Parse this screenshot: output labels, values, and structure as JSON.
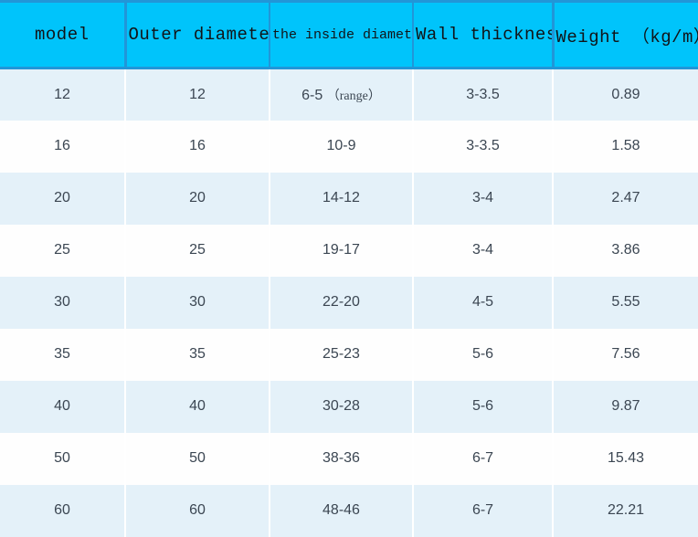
{
  "table": {
    "columns": [
      {
        "label": "model",
        "style": "mono"
      },
      {
        "label": "Outer diameter",
        "style": "mono"
      },
      {
        "label": "the inside diameter of",
        "style": "narrow"
      },
      {
        "label": "Wall thickness",
        "style": "mono"
      },
      {
        "label": "Weight （kg/m）",
        "style": "mono"
      }
    ],
    "rows": [
      {
        "model": "12",
        "outer_diameter": "12",
        "inside_diameter": "6-5",
        "inside_diameter_note": "（range）",
        "wall_thickness": "3-3.5",
        "weight": "0.89"
      },
      {
        "model": "16",
        "outer_diameter": "16",
        "inside_diameter": "10-9",
        "inside_diameter_note": "",
        "wall_thickness": "3-3.5",
        "weight": "1.58"
      },
      {
        "model": "20",
        "outer_diameter": "20",
        "inside_diameter": "14-12",
        "inside_diameter_note": "",
        "wall_thickness": "3-4",
        "weight": "2.47"
      },
      {
        "model": "25",
        "outer_diameter": "25",
        "inside_diameter": "19-17",
        "inside_diameter_note": "",
        "wall_thickness": "3-4",
        "weight": "3.86"
      },
      {
        "model": "30",
        "outer_diameter": "30",
        "inside_diameter": "22-20",
        "inside_diameter_note": "",
        "wall_thickness": "4-5",
        "weight": "5.55"
      },
      {
        "model": "35",
        "outer_diameter": "35",
        "inside_diameter": "25-23",
        "inside_diameter_note": "",
        "wall_thickness": "5-6",
        "weight": "7.56"
      },
      {
        "model": "40",
        "outer_diameter": "40",
        "inside_diameter": "30-28",
        "inside_diameter_note": "",
        "wall_thickness": "5-6",
        "weight": "9.87"
      },
      {
        "model": "50",
        "outer_diameter": "50",
        "inside_diameter": "38-36",
        "inside_diameter_note": "",
        "wall_thickness": "6-7",
        "weight": "15.43"
      },
      {
        "model": "60",
        "outer_diameter": "60",
        "inside_diameter": "48-46",
        "inside_diameter_note": "",
        "wall_thickness": "6-7",
        "weight": "22.21"
      }
    ]
  },
  "colors": {
    "header_fill": "#00c4fb",
    "header_border": "#2196d8",
    "row_tint": "#e4f1f9",
    "row_plain": "#fefefe",
    "text": "#3b4652"
  }
}
